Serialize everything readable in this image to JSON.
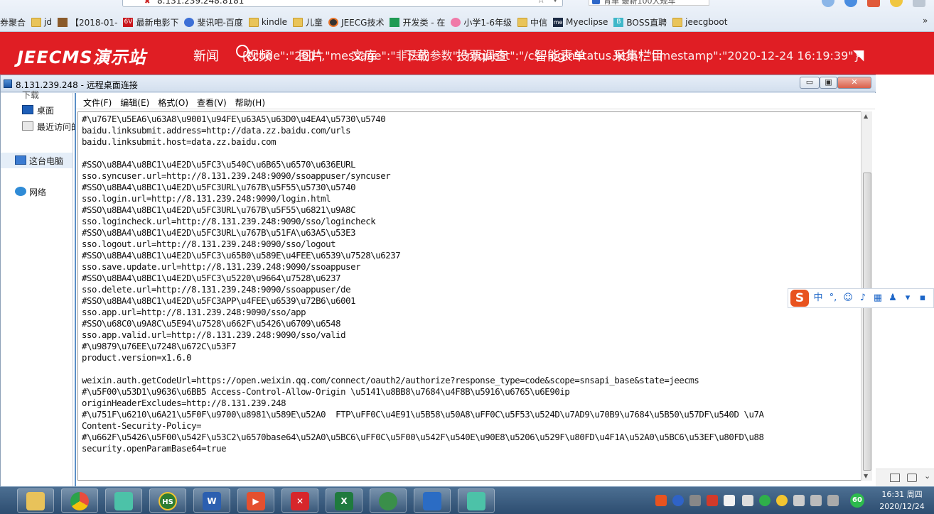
{
  "browser": {
    "address": "8.131.239.248:8181",
    "search_tab": "背单 最新100大规车",
    "bookmarks": [
      {
        "label": "券聚合",
        "icon": "none"
      },
      {
        "label": "jd",
        "icon": "folder"
      },
      {
        "label": "【2018-01-",
        "icon": "film"
      },
      {
        "label": "最新电影下",
        "icon": "6v"
      },
      {
        "label": "斐讯吧-百度",
        "icon": "paw"
      },
      {
        "label": "kindle",
        "icon": "folder"
      },
      {
        "label": "儿童",
        "icon": "folder"
      },
      {
        "label": "JEECG技术",
        "icon": "jeecg"
      },
      {
        "label": "开发类 - 在",
        "icon": "green"
      },
      {
        "label": "小学1-6年级",
        "icon": "pig"
      },
      {
        "label": "中信",
        "icon": "folder"
      },
      {
        "label": "Myeclipse",
        "icon": "me"
      },
      {
        "label": "BOSS直聘",
        "icon": "boss"
      },
      {
        "label": "jeecgboot",
        "icon": "folder"
      }
    ],
    "more": "»"
  },
  "site": {
    "logo": "JEECMS演示站",
    "nav": [
      "新闻",
      "视频",
      "图片",
      "文库",
      "下载",
      "投票调查",
      "智能表单",
      "采集栏目"
    ],
    "json_overlay": "{\"code\":\"201\",\"message\":\"非法的参数\",\"request\":\"/csi-loginStatus.htm\",\"timestamp\":\"2020-12-24 16:19:39\"}"
  },
  "rdp": {
    "title": "8.131.239.248 - 远程桌面连接",
    "min": "▭",
    "restore": "▣",
    "close": "✕"
  },
  "nav_pane": {
    "top_partial": "下载",
    "items": [
      "桌面",
      "最近访问的",
      "这台电脑",
      "网络"
    ]
  },
  "notepad": {
    "menu": [
      "文件(F)",
      "编辑(E)",
      "格式(O)",
      "查看(V)",
      "帮助(H)"
    ],
    "lines": [
      "#\\u767E\\u5EA6\\u63A8\\u9001\\u94FE\\u63A5\\u63D0\\u4EA4\\u5730\\u5740",
      "baidu.linksubmit.address=http://data.zz.baidu.com/urls",
      "baidu.linksubmit.host=data.zz.baidu.com",
      "",
      "#SSO\\u8BA4\\u8BC1\\u4E2D\\u5FC3\\u540C\\u6B65\\u6570\\u636EURL",
      "sso.syncuser.url=http://8.131.239.248:9090/ssoappuser/syncuser",
      "#SSO\\u8BA4\\u8BC1\\u4E2D\\u5FC3URL\\u767B\\u5F55\\u5730\\u5740",
      "sso.login.url=http://8.131.239.248:9090/login.html",
      "#SSO\\u8BA4\\u8BC1\\u4E2D\\u5FC3URL\\u767B\\u5F55\\u6821\\u9A8C",
      "sso.logincheck.url=http://8.131.239.248:9090/sso/logincheck",
      "#SSO\\u8BA4\\u8BC1\\u4E2D\\u5FC3URL\\u767B\\u51FA\\u63A5\\u53E3",
      "sso.logout.url=http://8.131.239.248:9090/sso/logout",
      "#SSO\\u8BA4\\u8BC1\\u4E2D\\u5FC3\\u65B0\\u589E\\u4FEE\\u6539\\u7528\\u6237",
      "sso.save.update.url=http://8.131.239.248:9090/ssoappuser",
      "#SSO\\u8BA4\\u8BC1\\u4E2D\\u5FC3\\u5220\\u9664\\u7528\\u6237",
      "sso.delete.url=http://8.131.239.248:9090/ssoappuser/de",
      "#SSO\\u8BA4\\u8BC1\\u4E2D\\u5FC3APP\\u4FEE\\u6539\\u72B6\\u6001",
      "sso.app.url=http://8.131.239.248:9090/sso/app",
      "#SSO\\u68C0\\u9A8C\\u5E94\\u7528\\u662F\\u5426\\u6709\\u6548",
      "sso.app.valid.url=http://8.131.239.248:9090/sso/valid",
      "#\\u9879\\u76EE\\u7248\\u672C\\u53F7",
      "product.version=x1.6.0",
      "",
      "weixin.auth.getCodeUrl=https://open.weixin.qq.com/connect/oauth2/authorize?response_type=code&scope=snsapi_base&state=jeecms",
      "#\\u5F00\\u53D1\\u9636\\u6BB5 Access-Control-Allow-Origin \\u5141\\u8BB8\\u7684\\u4F8B\\u5916\\u6765\\u6E90ip",
      "originHeaderExcludes=http://8.131.239.248",
      "#\\u751F\\u6210\\u6A21\\u5F0F\\u9700\\u8981\\u589E\\u52A0  FTP\\uFF0C\\u4E91\\u5B58\\u50A8\\uFF0C\\u5F53\\u524D\\u7AD9\\u70B9\\u7684\\u5B50\\u57DF\\u540D \\u7A",
      "Content-Security-Policy=",
      "#\\u662F\\u5426\\u5F00\\u542F\\u53C2\\u6570base64\\u52A0\\u5BC6\\uFF0C\\u5F00\\u542F\\u540E\\u90E8\\u5206\\u529F\\u80FD\\u4F1A\\u52A0\\u5BC6\\u53EF\\u80FD\\u88",
      "security.openParamBase64=true"
    ]
  },
  "ime": {
    "logo": "S",
    "mode": "中",
    "punct": "°,"
  },
  "taskbar": {
    "badge": "60",
    "time": "16:31 周四",
    "date": "2020/12/24"
  }
}
